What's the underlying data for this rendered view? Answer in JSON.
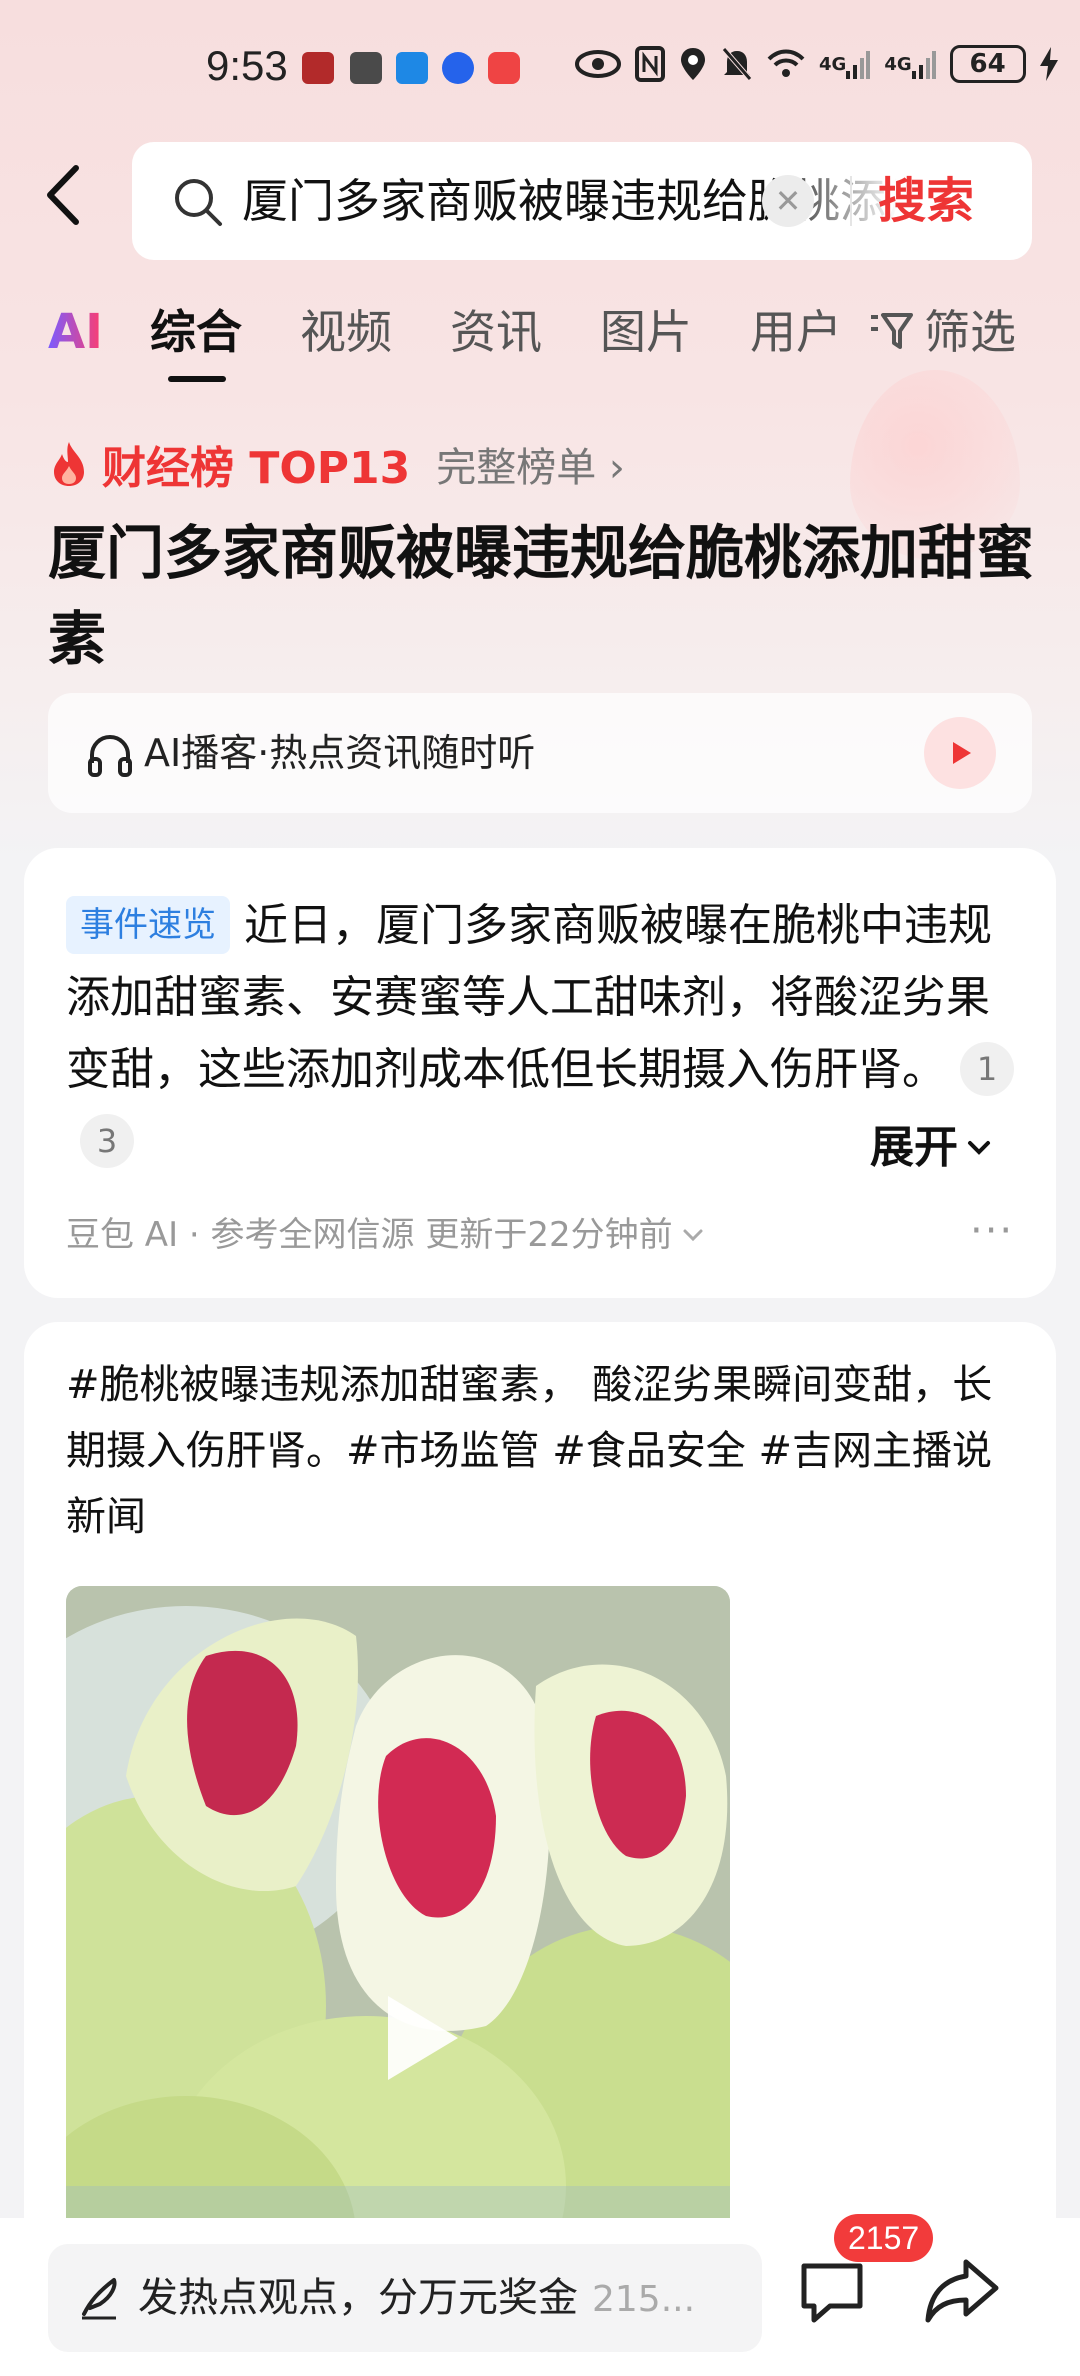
{
  "status_bar": {
    "time": "9:53",
    "battery": "64",
    "signal_1": "4G",
    "signal_2": "4G"
  },
  "search": {
    "query": "厦门多家商贩被曝违规给脆桃添加甜蜜素",
    "button_label": "搜索"
  },
  "tabs": [
    {
      "label": "AI"
    },
    {
      "label": "综合"
    },
    {
      "label": "视频"
    },
    {
      "label": "资讯"
    },
    {
      "label": "图片"
    },
    {
      "label": "用户"
    }
  ],
  "filter_label": "筛选",
  "hot_list": {
    "label": "财经榜 TOP13",
    "full_list": "完整榜单 ›"
  },
  "title": "厦门多家商贩被曝违规给脆桃添加甜蜜素",
  "podcast": {
    "text": "AI播客·热点资讯随时听"
  },
  "summary_card": {
    "badge": "事件速览",
    "text": "近日，厦门多家商贩被曝在脆桃中违规添加甜蜜素、安赛蜜等人工甜味剂，将酸涩劣果变甜，这些添加剂成本低但长期摄入伤肝肾。",
    "ref_1": "1",
    "ref_2": "3",
    "expand_label": "展开",
    "source": "豆包 AI · 参考全网信源 更新于22分钟前",
    "more": "···"
  },
  "post_card": {
    "text": "#脆桃被曝违规添加甜蜜素， 酸涩劣果瞬间变甜，长期摄入伤肝肾。#市场监管 #食品安全 #吉网主播说新闻"
  },
  "bottom_bar": {
    "comment_placeholder": "发热点观点，分万元奖金",
    "comment_count_inline": "215...",
    "comment_badge": "2157"
  },
  "colors": {
    "accent": "#ee3535",
    "badge_blue": "#2d7fe0",
    "badge_bg": "#e7f2ff"
  }
}
